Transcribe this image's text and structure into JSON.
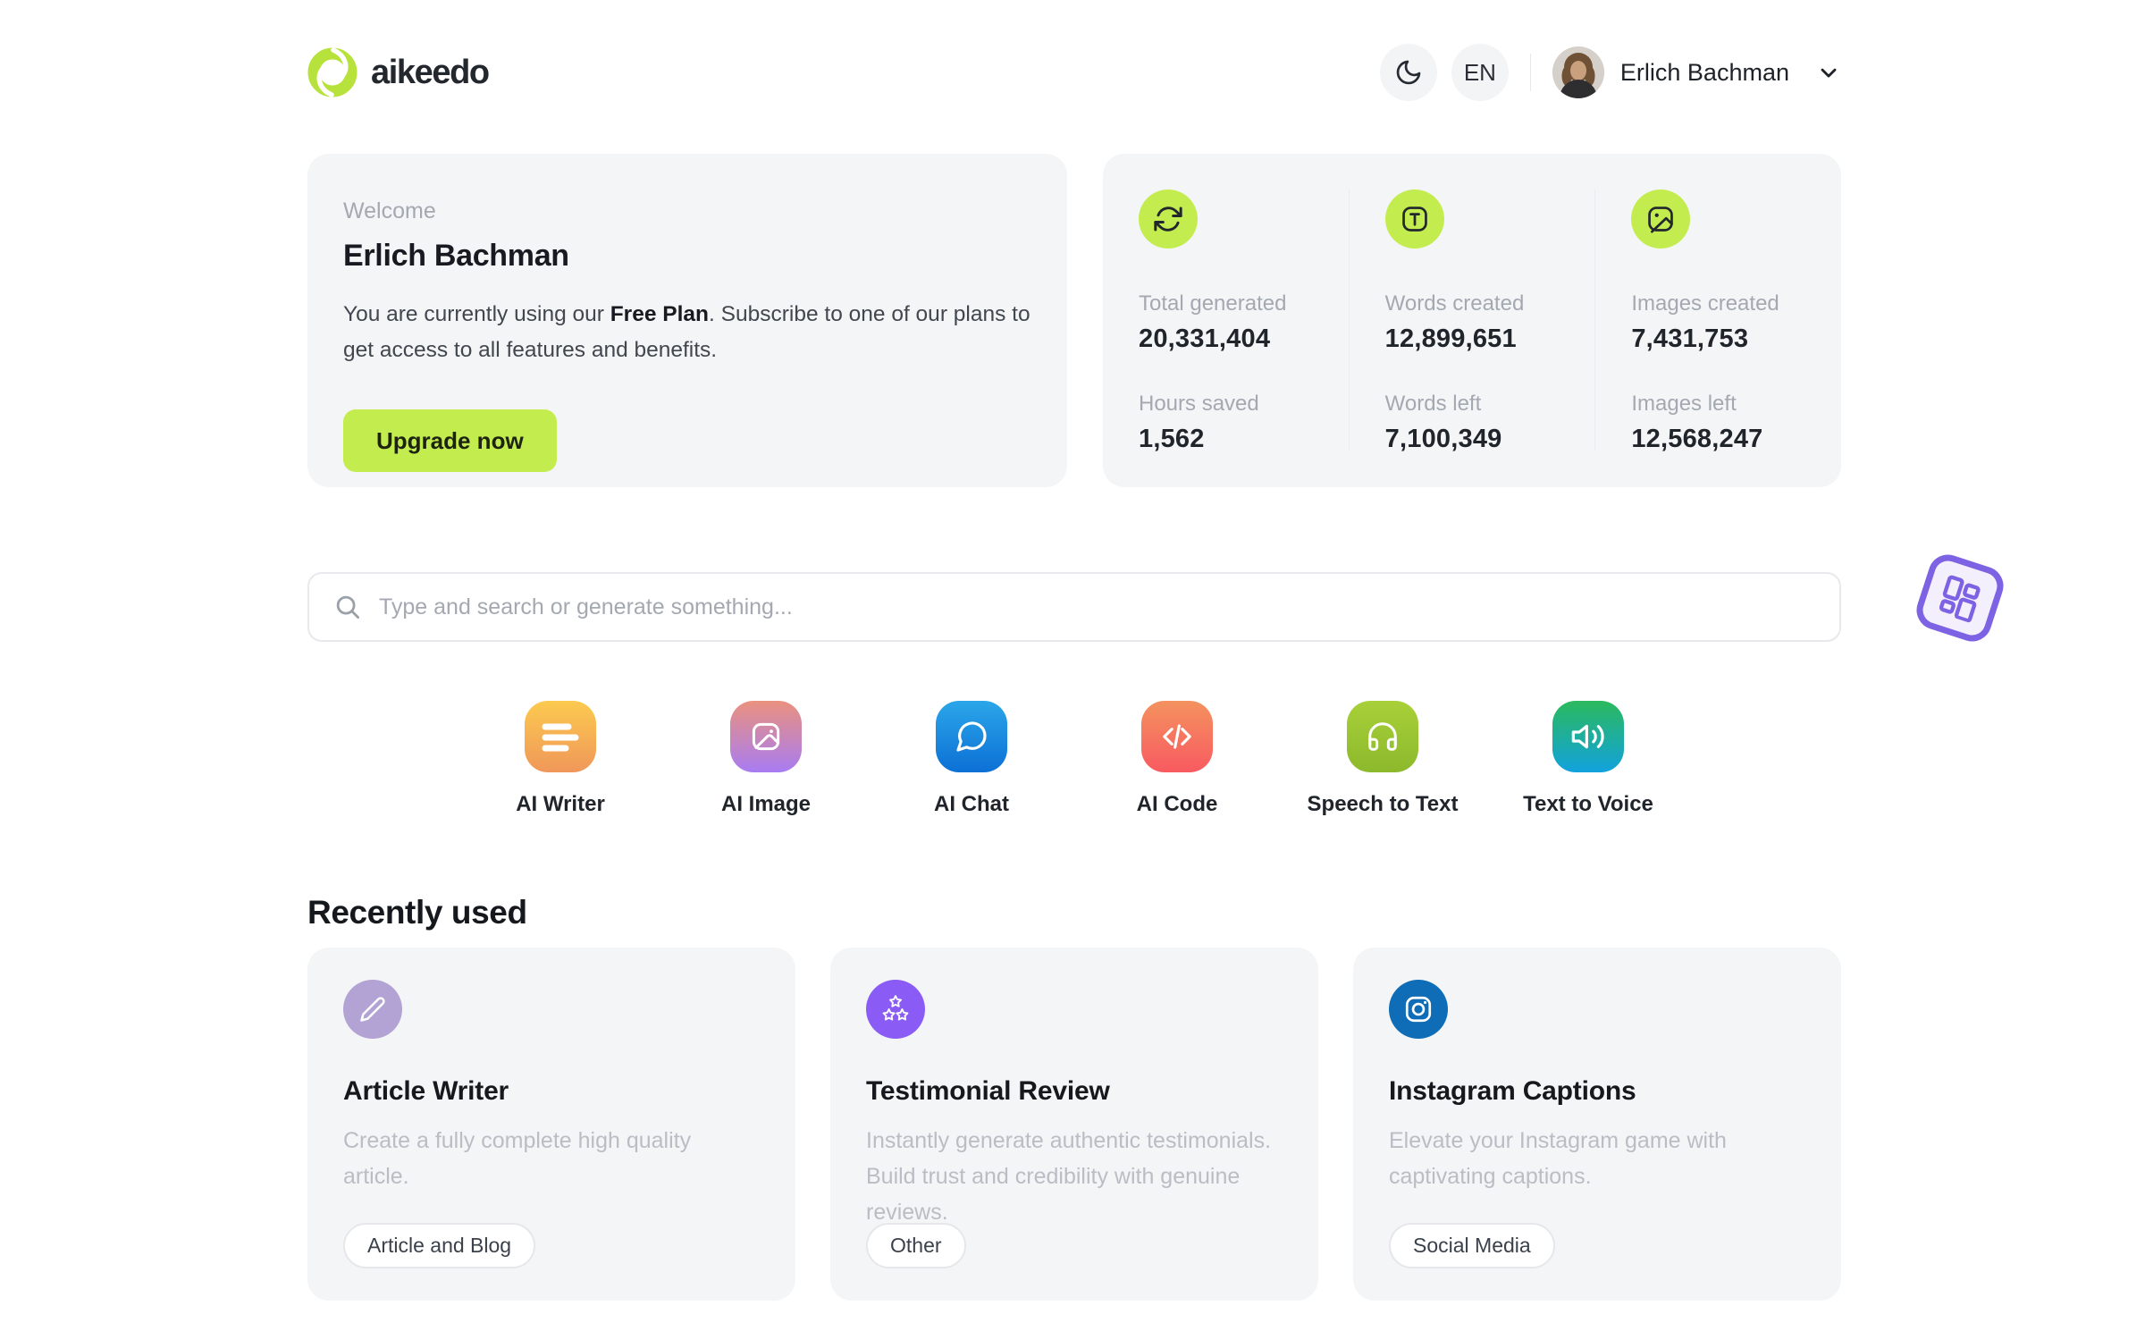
{
  "header": {
    "brand": "aikeedo",
    "brand_icon": "swirl-logo-icon",
    "dark_mode_icon": "moon-icon",
    "language": "EN",
    "user_name": "Erlich Bachman",
    "user_menu_icon": "chevron-down-icon"
  },
  "welcome": {
    "eyebrow": "Welcome",
    "name": "Erlich Bachman",
    "body_prefix": "You are currently using our ",
    "plan": "Free Plan",
    "body_suffix": ". Subscribe to one of our plans to get access to all features and benefits.",
    "cta": "Upgrade now"
  },
  "stats": {
    "columns": [
      {
        "icon": "sync-icon",
        "rows": [
          {
            "label": "Total generated",
            "value": "20,331,404"
          },
          {
            "label": "Hours saved",
            "value": "1,562"
          }
        ]
      },
      {
        "icon": "text-t-icon",
        "rows": [
          {
            "label": "Words created",
            "value": "12,899,651"
          },
          {
            "label": "Words left",
            "value": "7,100,349"
          }
        ]
      },
      {
        "icon": "image-icon",
        "rows": [
          {
            "label": "Images created",
            "value": "7,431,753"
          },
          {
            "label": "Images left",
            "value": "12,568,247"
          }
        ]
      }
    ]
  },
  "search": {
    "icon": "search-icon",
    "placeholder": "Type and search or generate something..."
  },
  "tools": [
    {
      "label": "AI Writer",
      "icon": "text-lines-icon",
      "gradient_from": "#fcca4f",
      "gradient_to": "#f0975a"
    },
    {
      "label": "AI Image",
      "icon": "image-icon",
      "gradient_from": "#ea917e",
      "gradient_to": "#a87cf2"
    },
    {
      "label": "AI Chat",
      "icon": "chat-bubble-icon",
      "gradient_from": "#2ba6e9",
      "gradient_to": "#0c70d5"
    },
    {
      "label": "AI Code",
      "icon": "code-icon",
      "gradient_from": "#f4925f",
      "gradient_to": "#f85a60"
    },
    {
      "label": "Speech to Text",
      "icon": "headphones-icon",
      "gradient_from": "#a8d039",
      "gradient_to": "#8cb92c"
    },
    {
      "label": "Text to Voice",
      "icon": "speaker-icon",
      "gradient_from": "#2bb95d",
      "gradient_to": "#12a2dd"
    }
  ],
  "recent": {
    "heading": "Recently used",
    "cards": [
      {
        "title": "Article Writer",
        "description": "Create a fully complete high quality article.",
        "tag": "Article and Blog",
        "icon": "pencil-icon",
        "icon_color": "#b2a3d4"
      },
      {
        "title": "Testimonial Review",
        "description": "Instantly generate authentic testimonials. Build trust and credibility with genuine reviews.",
        "tag": "Other",
        "icon": "stars-icon",
        "icon_color": "#8a5cf5"
      },
      {
        "title": "Instagram Captions",
        "description": "Elevate your Instagram game with captivating captions.",
        "tag": "Social Media",
        "icon": "instagram-icon",
        "icon_color": "#0e6db6"
      }
    ]
  },
  "floating_widget": {
    "icon": "dashboard-grid-icon",
    "color": "#7d62e4"
  },
  "colors": {
    "accent_lime": "#c3ec4f",
    "card_background": "#f4f5f7",
    "heading_text": "#15181d",
    "muted_text": "#a3a8b1",
    "description_text": "#b9bdc4",
    "widget_purple": "#7d62e4"
  }
}
